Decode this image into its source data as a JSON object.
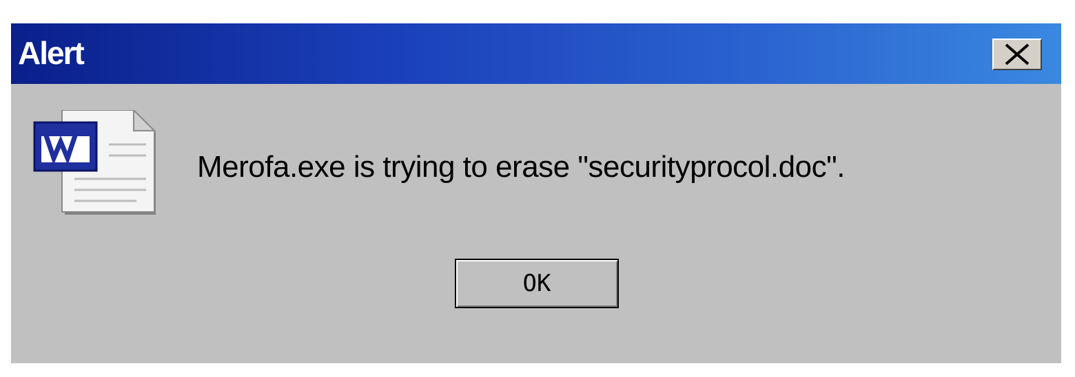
{
  "dialog": {
    "title": "Alert",
    "message": "Merofa.exe is trying to erase \"securityprocol.doc\".",
    "ok_label": "OK",
    "icon": "word-document-icon",
    "close_icon": "close-icon"
  },
  "colors": {
    "titlebar_start": "#0a1f8a",
    "titlebar_end": "#3a88e0",
    "body": "#c0c0c0",
    "title_text": "#ffffff"
  }
}
